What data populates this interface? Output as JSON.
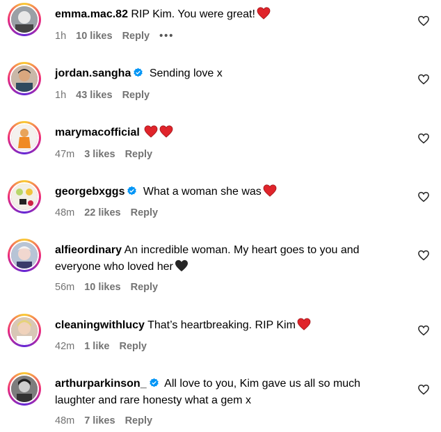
{
  "comments": [
    {
      "username": "emma.mac.82",
      "verified": false,
      "text": "RIP Kim. You were great!",
      "heart": "red",
      "hearts": 1,
      "time": "1h",
      "likes": "10 likes",
      "reply": "Reply",
      "more": "•••",
      "avatar": "avatar-emma"
    },
    {
      "username": "jordan.sangha",
      "verified": true,
      "text": "Sending love x",
      "heart": "none",
      "hearts": 0,
      "time": "1h",
      "likes": "43 likes",
      "reply": "Reply",
      "avatar": "avatar-jordan"
    },
    {
      "username": "marymacofficial",
      "verified": false,
      "text": "",
      "heart": "red",
      "hearts": 2,
      "time": "47m",
      "likes": "3 likes",
      "reply": "Reply",
      "avatar": "avatar-mary"
    },
    {
      "username": "georgebxggs",
      "verified": true,
      "text": "What a woman she was",
      "heart": "red",
      "hearts": 1,
      "time": "48m",
      "likes": "22 likes",
      "reply": "Reply",
      "avatar": "avatar-george"
    },
    {
      "username": "alfieordinary",
      "verified": false,
      "text": "An incredible woman. My heart goes to you and",
      "text2": "everyone who loved her",
      "heart": "black",
      "hearts": 1,
      "time": "56m",
      "likes": "10 likes",
      "reply": "Reply",
      "avatar": "avatar-alfie"
    },
    {
      "username": "cleaningwithlucy",
      "verified": false,
      "text": "That’s heartbreaking. RIP Kim",
      "heart": "red",
      "hearts": 1,
      "time": "42m",
      "likes": "1 like",
      "reply": "Reply",
      "avatar": "avatar-lucy"
    },
    {
      "username": "arthurparkinson_",
      "verified": true,
      "text": "All love to you, Kim gave us all so much",
      "text2": "laughter and rare honesty what a gem x",
      "heart": "none",
      "hearts": 0,
      "time": "48m",
      "likes": "7 likes",
      "reply": "Reply",
      "avatar": "avatar-arthur"
    }
  ],
  "colors": {
    "heart_red": "#e0242b",
    "heart_black": "#262626",
    "verified_blue": "#0095f6",
    "meta_gray": "#737373"
  },
  "icons": {
    "like": "heart-outline-icon",
    "verified": "verified-badge-icon"
  }
}
